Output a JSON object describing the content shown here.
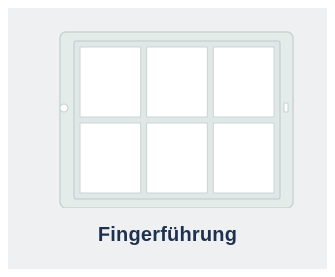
{
  "product": {
    "title": "Fingerführung",
    "image_icon": "keyguard-grid-icon",
    "grid": {
      "rows": 2,
      "columns": 3
    }
  },
  "colors": {
    "card_background": "#eef0f2",
    "frame": "#e4ecea",
    "frame_stroke": "#c9d4d2",
    "cell": "#ffffff",
    "title": "#1f3150"
  }
}
